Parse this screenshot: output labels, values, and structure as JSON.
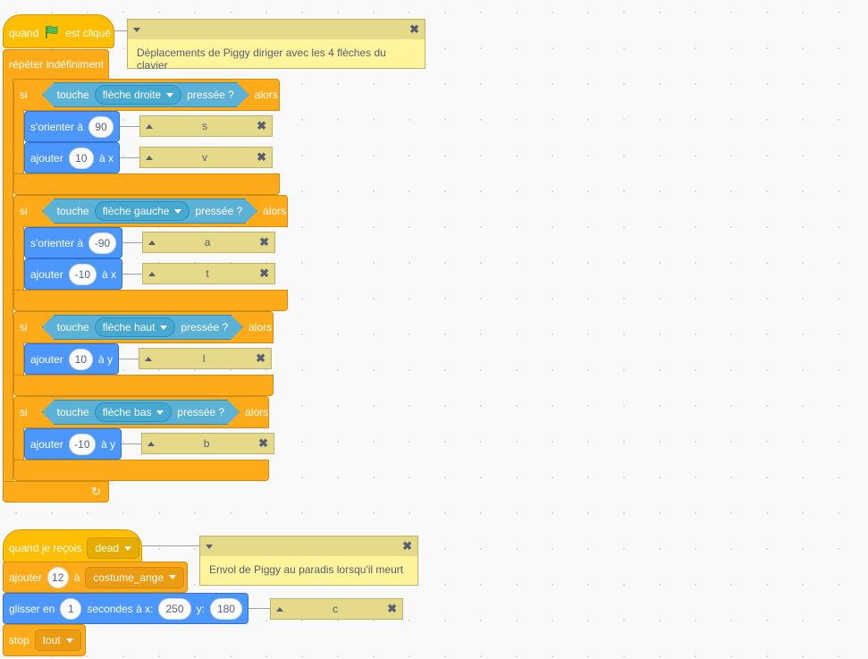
{
  "script1": {
    "hat": {
      "quand": "quand",
      "suffix": "est cliqué"
    },
    "note": "Déplacements de Piggy diriger avec les 4 flèches du clavier",
    "forever": "répéter indéfiniment",
    "ifs": [
      {
        "si": "si",
        "touche": "touche",
        "key": "flèche droite",
        "pressee": "pressée ?",
        "alors": "alors",
        "orient_label": "s'orienter à",
        "orient_value": "90",
        "orient_comment": "s",
        "add_label": "ajouter",
        "add_value": "10",
        "add_axis": "à x",
        "add_comment": "v"
      },
      {
        "si": "si",
        "touche": "touche",
        "key": "flèche gauche",
        "pressee": "pressée ?",
        "alors": "alors",
        "orient_label": "s'orienter à",
        "orient_value": "-90",
        "orient_comment": "a",
        "add_label": "ajouter",
        "add_value": "-10",
        "add_axis": "à x",
        "add_comment": "t"
      },
      {
        "si": "si",
        "touche": "touche",
        "key": "flèche haut",
        "pressee": "pressée ?",
        "alors": "alors",
        "add_label": "ajouter",
        "add_value": "10",
        "add_axis": "à y",
        "add_comment": "l"
      },
      {
        "si": "si",
        "touche": "touche",
        "key": "flèche bas",
        "pressee": "pressée ?",
        "alors": "alors",
        "add_label": "ajouter",
        "add_value": "-10",
        "add_axis": "à y",
        "add_comment": "b"
      }
    ],
    "loop_arrow": "↻"
  },
  "script2": {
    "hat": {
      "label": "quand je reçois",
      "message": "dead"
    },
    "note": "Envol de Piggy au paradis lorsqu'il meurt",
    "effect": {
      "label": "ajouter",
      "value": "12",
      "to": "à",
      "target": "costume_ange"
    },
    "glide": {
      "label": "glisser en",
      "secs": "1",
      "secs_label": "secondes à x:",
      "x": "250",
      "y_label": "y:",
      "y": "180",
      "comment": "c"
    },
    "stop": {
      "label": "stop",
      "option": "tout"
    }
  },
  "colors": {
    "events": "#ffbf00",
    "control": "#ffab19",
    "motion": "#4c97ff",
    "sensing": "#5cb1d6",
    "note": "#fef49c"
  }
}
